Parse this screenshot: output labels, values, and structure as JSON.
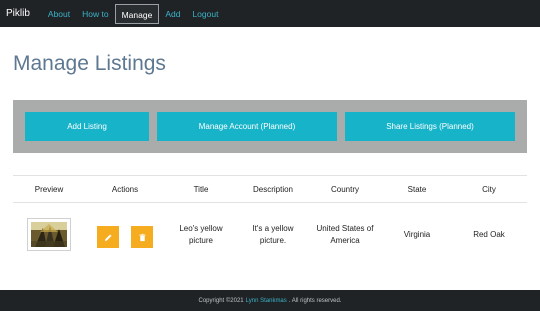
{
  "nav": {
    "brand": "Piklib",
    "links": [
      {
        "label": "About"
      },
      {
        "label": "How to"
      },
      {
        "label": "Manage"
      },
      {
        "label": "Add"
      },
      {
        "label": "Logout"
      }
    ]
  },
  "page_title": "Manage Listings",
  "actions": {
    "add_listing": "Add Listing",
    "manage_account": "Manage Account (Planned)",
    "share_listings": "Share Listings (Planned)"
  },
  "table": {
    "headers": [
      "Preview",
      "Actions",
      "Title",
      "Description",
      "Country",
      "State",
      "City"
    ],
    "rows": [
      {
        "title": "Leo's yellow picture",
        "description": "It's a yellow picture.",
        "country": "United States of America",
        "state": "Virginia",
        "city": "Red Oak"
      }
    ]
  },
  "footer": {
    "prefix": "Copyright ©2021",
    "author": "Lynn Stankmas",
    "suffix": ". All rights reserved."
  },
  "colors": {
    "accent": "#17b3c9",
    "action_button": "#f5ad1f",
    "nav_bg": "#202326"
  },
  "icons": {
    "edit": "pencil-icon",
    "delete": "trash-icon"
  }
}
